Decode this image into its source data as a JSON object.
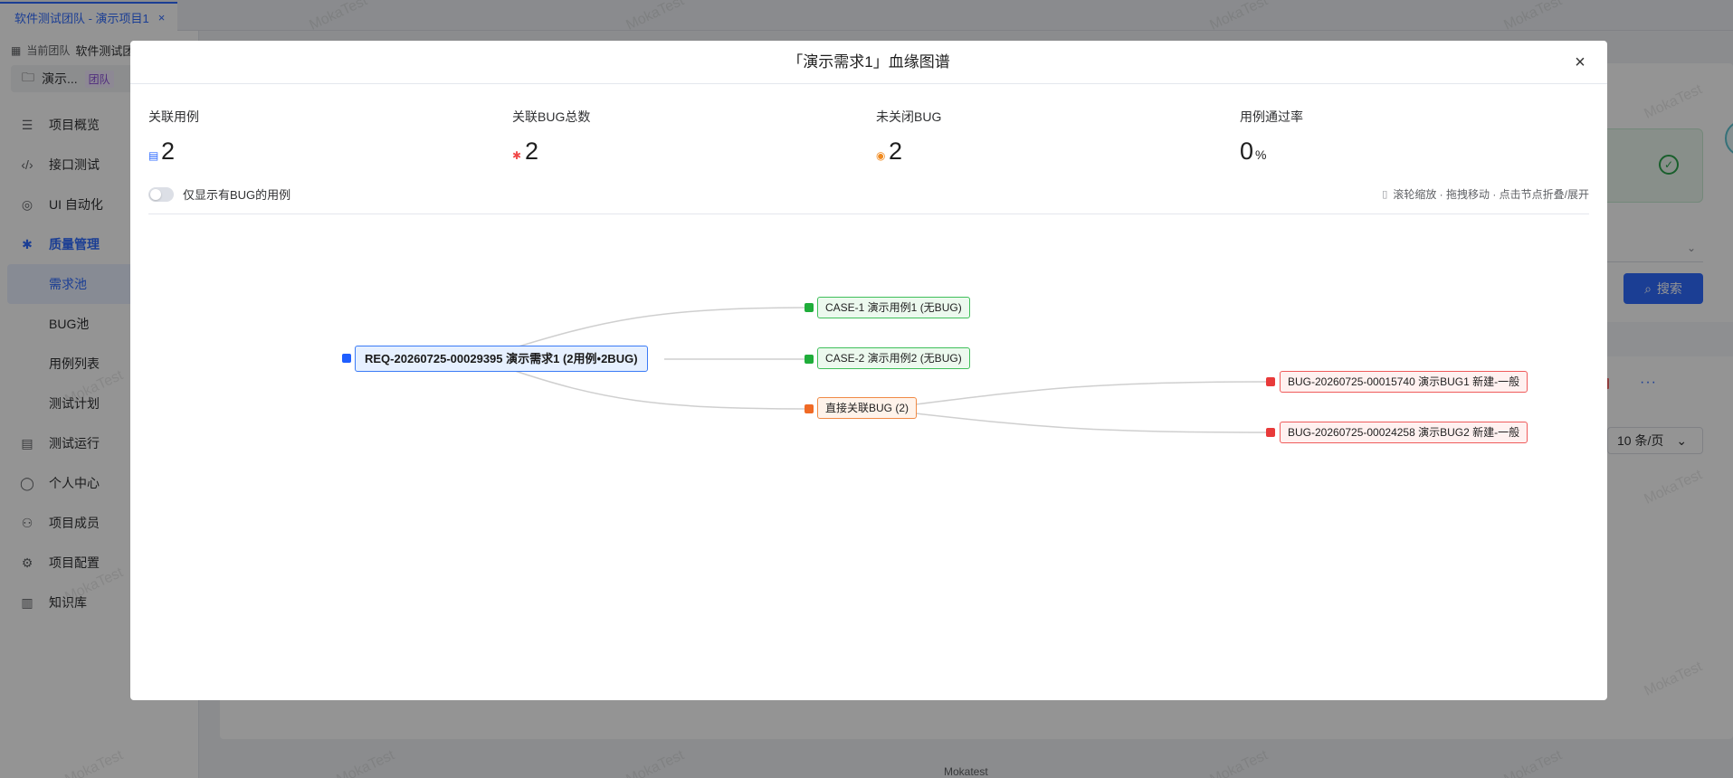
{
  "tabbar": {
    "tab_label": "软件测试团队 - 演示项目1",
    "tab_close": "×"
  },
  "sidebar": {
    "team_prefix": "当前团队",
    "team_name": "软件测试团",
    "project_name": "演示...",
    "project_tag": "团队",
    "items": [
      {
        "label": "项目概览",
        "icon": "list-icon"
      },
      {
        "label": "接口测试",
        "icon": "code-icon"
      },
      {
        "label": "UI 自动化",
        "icon": "check-circle-icon"
      },
      {
        "label": "质量管理",
        "icon": "bug-icon"
      },
      {
        "label": "需求池"
      },
      {
        "label": "BUG池"
      },
      {
        "label": "用例列表"
      },
      {
        "label": "测试计划"
      },
      {
        "label": "测试运行",
        "icon": "run-icon"
      },
      {
        "label": "个人中心",
        "icon": "user-icon"
      },
      {
        "label": "项目成员",
        "icon": "team-icon"
      },
      {
        "label": "项目配置",
        "icon": "gear-icon"
      },
      {
        "label": "知识库",
        "icon": "book-icon"
      }
    ]
  },
  "background": {
    "search_label": "搜索",
    "page_size": "10 条/页",
    "footer_brand": "Mokatest",
    "watermark": "MokaTest",
    "more": "···"
  },
  "modal": {
    "title": "「演示需求1」血缘图谱",
    "close": "×",
    "stats": [
      {
        "label": "关联用例",
        "value": "2",
        "unit": "",
        "icon": "document-icon",
        "color": "#2f6bff"
      },
      {
        "label": "关联BUG总数",
        "value": "2",
        "unit": "",
        "icon": "bug-icon",
        "color": "#f04848"
      },
      {
        "label": "未关闭BUG",
        "value": "2",
        "unit": "",
        "icon": "alert-circle-icon",
        "color": "#f08a20"
      },
      {
        "label": "用例通过率",
        "value": "0",
        "unit": "%",
        "icon": "",
        "color": "#1f1f1f"
      }
    ],
    "toggle_label": "仅显示有BUG的用例",
    "toggle_on": false,
    "hint": "滚轮缩放 · 拖拽移动 · 点击节点折叠/展开"
  },
  "graph": {
    "root": "REQ-20260725-00029395 演示需求1 (2用例•2BUG)",
    "case1": "CASE-1 演示用例1 (无BUG)",
    "case2": "CASE-2 演示用例2 (无BUG)",
    "bug_group": "直接关联BUG (2)",
    "bug1": "BUG-20260725-00015740 演示BUG1 新建-一般",
    "bug2": "BUG-20260725-00024258 演示BUG2 新建-一般",
    "colors": {
      "requirement": "#1f5eff",
      "case": "#1fad3a",
      "bug_group": "#f06a25",
      "bug": "#e83a3a"
    }
  }
}
